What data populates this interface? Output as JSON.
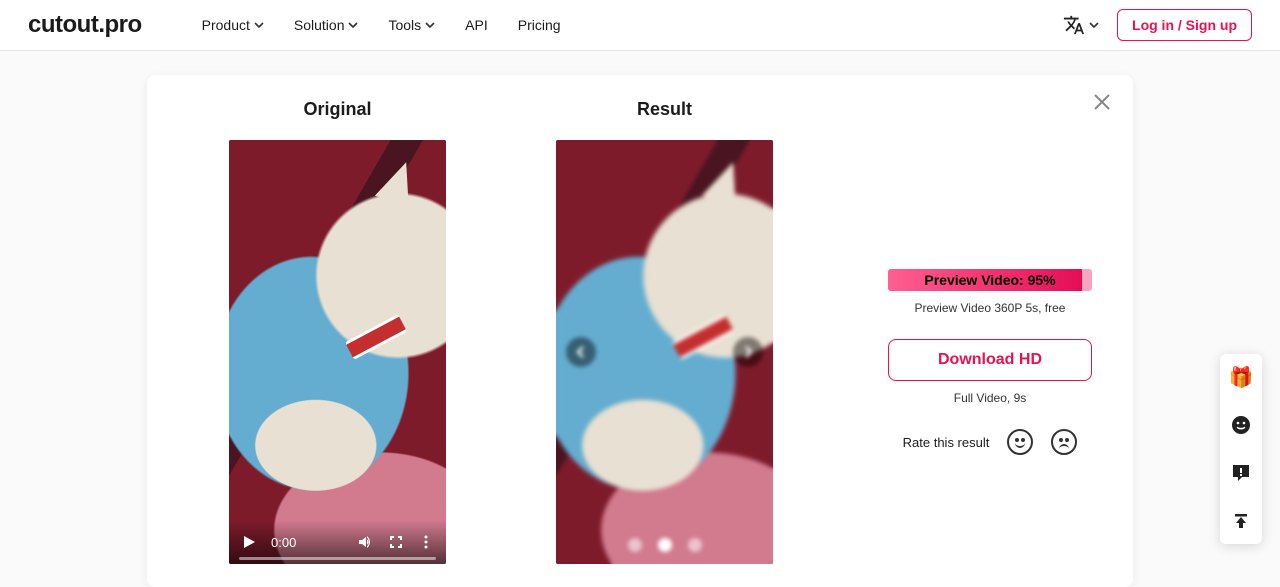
{
  "brand": "cutout.pro",
  "nav": {
    "product": "Product",
    "solution": "Solution",
    "tools": "Tools",
    "api": "API",
    "pricing": "Pricing"
  },
  "header": {
    "login": "Log in / Sign up"
  },
  "labels": {
    "original": "Original",
    "result": "Result"
  },
  "video": {
    "current_time": "0:00"
  },
  "progress": {
    "text": "Preview Video: 95%",
    "percent": 95
  },
  "preview_info": "Preview Video 360P 5s, free",
  "download": "Download HD",
  "full_video_info": "Full Video, 9s",
  "rate_label": "Rate this result",
  "carousel": {
    "total_dots": 3,
    "active_dot_index": 1
  },
  "icons": {
    "language": "translate",
    "close": "close",
    "play": "play",
    "volume": "volume",
    "fullscreen": "fullscreen",
    "more": "more-vert",
    "chev_left": "chevron-left",
    "chev_right": "chevron-right",
    "gift": "🎁",
    "support": "support-face",
    "feedback": "feedback-bubble",
    "top": "back-to-top"
  }
}
